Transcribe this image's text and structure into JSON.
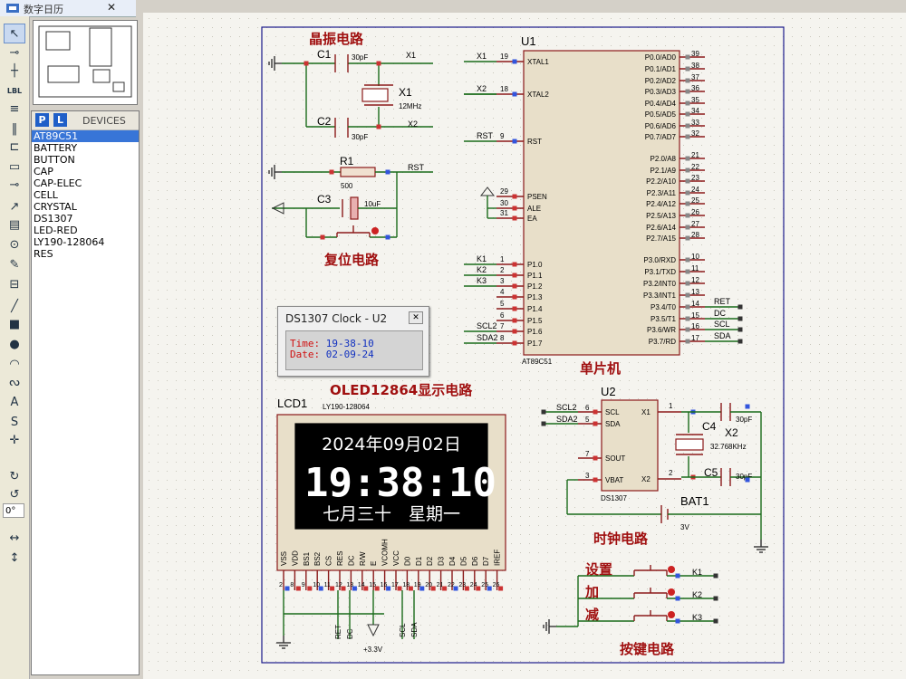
{
  "window": {
    "title": "数字日历"
  },
  "toolbar": {
    "icons": [
      "pointer-icon",
      "component-icon",
      "junction-icon",
      "label-icon",
      "text-script-icon",
      "bus-icon",
      "subcircuit-icon",
      "terminal-icon",
      "pin-icon",
      "graph-icon",
      "tape-icon",
      "generator-icon",
      "probe-icon",
      "instrument-icon",
      "line-icon",
      "box-icon",
      "circle-icon",
      "arc-icon",
      "path-icon",
      "text-icon",
      "symbol-icon",
      "marker-icon",
      "rotate-cw-icon",
      "rotate-ccw-icon",
      "mirror-x-icon",
      "mirror-y-icon"
    ],
    "angle_value": "0°"
  },
  "devices": {
    "p": "P",
    "l": "L",
    "title": "DEVICES",
    "items": [
      "AT89C51",
      "BATTERY",
      "BUTTON",
      "CAP",
      "CAP-ELEC",
      "CELL",
      "CRYSTAL",
      "DS1307",
      "LED-RED",
      "LY190-128064",
      "RES"
    ],
    "selected": 0
  },
  "schematic": {
    "section_labels": {
      "crystal": "晶振电路",
      "reset": "复位电路",
      "mcu": "单片机",
      "oled": "OLED12864显示电路",
      "clock": "时钟电路",
      "keys": "按键电路"
    },
    "c1": {
      "name": "C1",
      "value": "30pF"
    },
    "c2": {
      "name": "C2",
      "value": "30pF"
    },
    "x1": {
      "name": "X1",
      "value": "12MHz"
    },
    "r1": {
      "name": "R1",
      "value": "500"
    },
    "c3": {
      "name": "C3",
      "value": "10uF"
    },
    "nets": {
      "x1": "X1",
      "x2": "X2",
      "rst": "RST"
    },
    "u1": {
      "ref": "U1",
      "part": "AT89C51",
      "left_pins": [
        {
          "net": "X1",
          "num": "19",
          "name": "XTAL1"
        },
        {
          "net": "X2",
          "num": "18",
          "name": "XTAL2"
        },
        {
          "net": "RST",
          "num": "9",
          "name": "RST"
        },
        {
          "net": "",
          "num": "29",
          "name": "PSEN"
        },
        {
          "net": "",
          "num": "30",
          "name": "ALE"
        },
        {
          "net": "",
          "num": "31",
          "name": "EA"
        },
        {
          "net": "K1",
          "num": "1",
          "name": "P1.0"
        },
        {
          "net": "K2",
          "num": "2",
          "name": "P1.1"
        },
        {
          "net": "K3",
          "num": "3",
          "name": "P1.2"
        },
        {
          "net": "",
          "num": "4",
          "name": "P1.3"
        },
        {
          "net": "",
          "num": "5",
          "name": "P1.4"
        },
        {
          "net": "",
          "num": "6",
          "name": "P1.5"
        },
        {
          "net": "SCL2",
          "num": "7",
          "name": "P1.6"
        },
        {
          "net": "SDA2",
          "num": "8",
          "name": "P1.7"
        }
      ],
      "right_pins": [
        {
          "name": "P0.0/AD0",
          "num": "39",
          "net": ""
        },
        {
          "name": "P0.1/AD1",
          "num": "38",
          "net": ""
        },
        {
          "name": "P0.2/AD2",
          "num": "37",
          "net": ""
        },
        {
          "name": "P0.3/AD3",
          "num": "36",
          "net": ""
        },
        {
          "name": "P0.4/AD4",
          "num": "35",
          "net": ""
        },
        {
          "name": "P0.5/AD5",
          "num": "34",
          "net": ""
        },
        {
          "name": "P0.6/AD6",
          "num": "33",
          "net": ""
        },
        {
          "name": "P0.7/AD7",
          "num": "32",
          "net": ""
        },
        {
          "name": "P2.0/A8",
          "num": "21",
          "net": ""
        },
        {
          "name": "P2.1/A9",
          "num": "22",
          "net": ""
        },
        {
          "name": "P2.2/A10",
          "num": "23",
          "net": ""
        },
        {
          "name": "P2.3/A11",
          "num": "24",
          "net": ""
        },
        {
          "name": "P2.4/A12",
          "num": "25",
          "net": ""
        },
        {
          "name": "P2.5/A13",
          "num": "26",
          "net": ""
        },
        {
          "name": "P2.6/A14",
          "num": "27",
          "net": ""
        },
        {
          "name": "P2.7/A15",
          "num": "28",
          "net": ""
        },
        {
          "name": "P3.0/RXD",
          "num": "10",
          "net": ""
        },
        {
          "name": "P3.1/TXD",
          "num": "11",
          "net": ""
        },
        {
          "name": "P3.2/INT0",
          "num": "12",
          "net": ""
        },
        {
          "name": "P3.3/INT1",
          "num": "13",
          "net": ""
        },
        {
          "name": "P3.4/T0",
          "num": "14",
          "net": "RET"
        },
        {
          "name": "P3.5/T1",
          "num": "15",
          "net": "DC"
        },
        {
          "name": "P3.6/WR",
          "num": "16",
          "net": "SCL"
        },
        {
          "name": "P3.7/RD",
          "num": "17",
          "net": "SDA"
        }
      ]
    },
    "u2": {
      "ref": "U2",
      "part": "DS1307",
      "pins": [
        {
          "net": "SCL2",
          "num": "6",
          "name": "SCL"
        },
        {
          "net": "SDA2",
          "num": "5",
          "name": "SDA"
        },
        {
          "net": "",
          "num": "7",
          "name": "SOUT"
        },
        {
          "net": "",
          "num": "3",
          "name": "VBAT"
        }
      ],
      "right_pins": [
        {
          "name": "X1",
          "num": "1"
        },
        {
          "name": "X2",
          "num": "2"
        }
      ]
    },
    "c4": {
      "name": "C4",
      "value": "30pF"
    },
    "c5": {
      "name": "C5",
      "value": "30pF"
    },
    "x2": {
      "name": "X2",
      "value": "32.768KHz"
    },
    "bat1": {
      "name": "BAT1",
      "value": "3V"
    },
    "lcd": {
      "ref": "LCD1",
      "part": "LY190-128064",
      "line1": "2024年09月02日",
      "line2": "19:38:10",
      "line3": "七月三十　星期一",
      "pins": [
        "VSS",
        "VDD",
        "BS1",
        "BS2",
        "CS",
        "RES",
        "DC",
        "R/W",
        "E",
        "VCOMH",
        "VCC",
        "D0",
        "D1",
        "D2",
        "D3",
        "D4",
        "D5",
        "D6",
        "D7",
        "IREF"
      ],
      "pin_nums": [
        "2",
        "8",
        "9",
        "10",
        "11",
        "12",
        "13",
        "14",
        "15",
        "16",
        "17",
        "18",
        "19",
        "20",
        "21",
        "22",
        "23",
        "24",
        "25",
        "26"
      ],
      "bottom_nets": [
        "RET",
        "DC",
        "SCL",
        "SDA"
      ],
      "vcc": "+3.3V"
    },
    "keys": [
      {
        "label": "设置",
        "net": "K1"
      },
      {
        "label": "加",
        "net": "K2"
      },
      {
        "label": "减",
        "net": "K3"
      }
    ]
  },
  "ds1307_window": {
    "title": "DS1307 Clock - U2",
    "time_label": "Time:",
    "time_value": "19-38-10",
    "date_label": "Date:",
    "date_value": "02-09-24"
  }
}
